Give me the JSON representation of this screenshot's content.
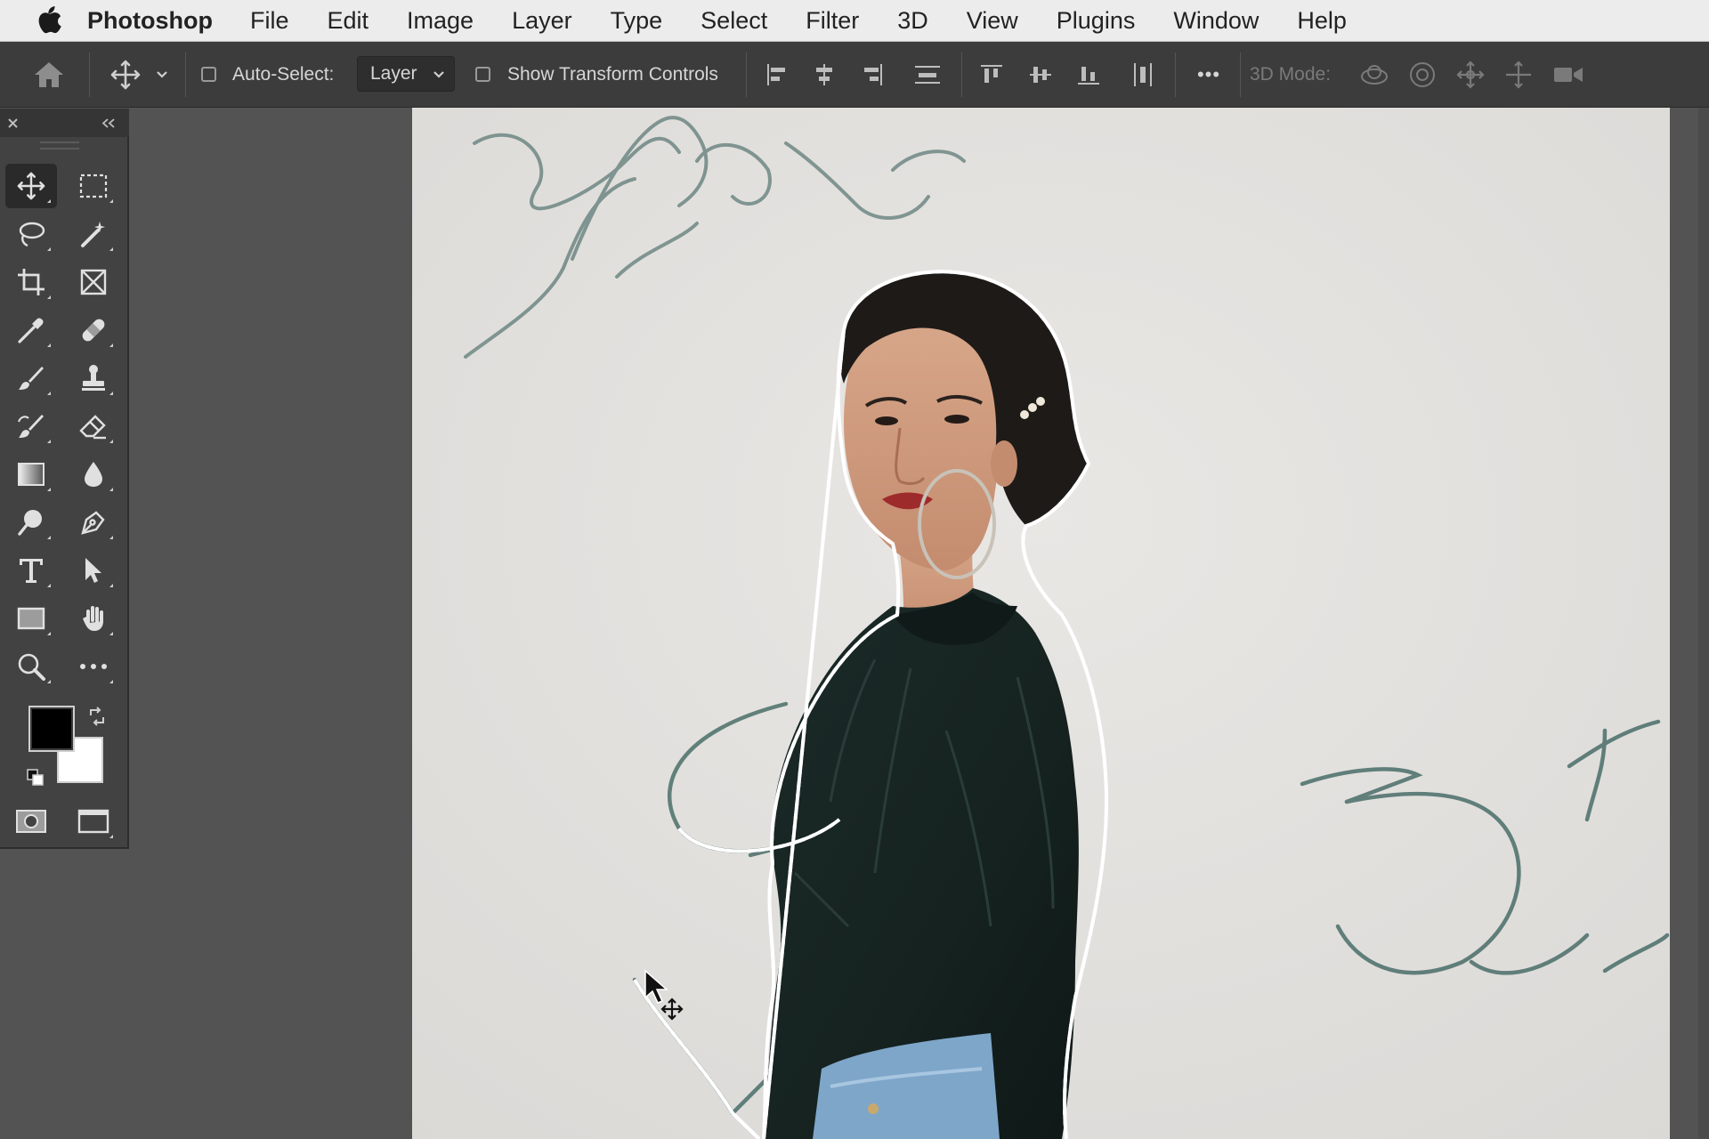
{
  "menubar": {
    "app_name": "Photoshop",
    "items": [
      "File",
      "Edit",
      "Image",
      "Layer",
      "Type",
      "Select",
      "Filter",
      "3D",
      "View",
      "Plugins",
      "Window",
      "Help"
    ]
  },
  "options_bar": {
    "auto_select_label": "Auto-Select:",
    "auto_select_checked": false,
    "auto_select_target": "Layer",
    "show_transform_label": "Show Transform Controls",
    "show_transform_checked": false,
    "mode_3d_label": "3D Mode:",
    "more_label": "•••"
  },
  "tools_panel": {
    "selected_tool": "move-tool",
    "foreground_color": "#000000",
    "background_color": "#ffffff"
  },
  "canvas": {
    "background_color": "#e4e2df",
    "subject": "woman in dark green shirt with marching-ants selection"
  }
}
